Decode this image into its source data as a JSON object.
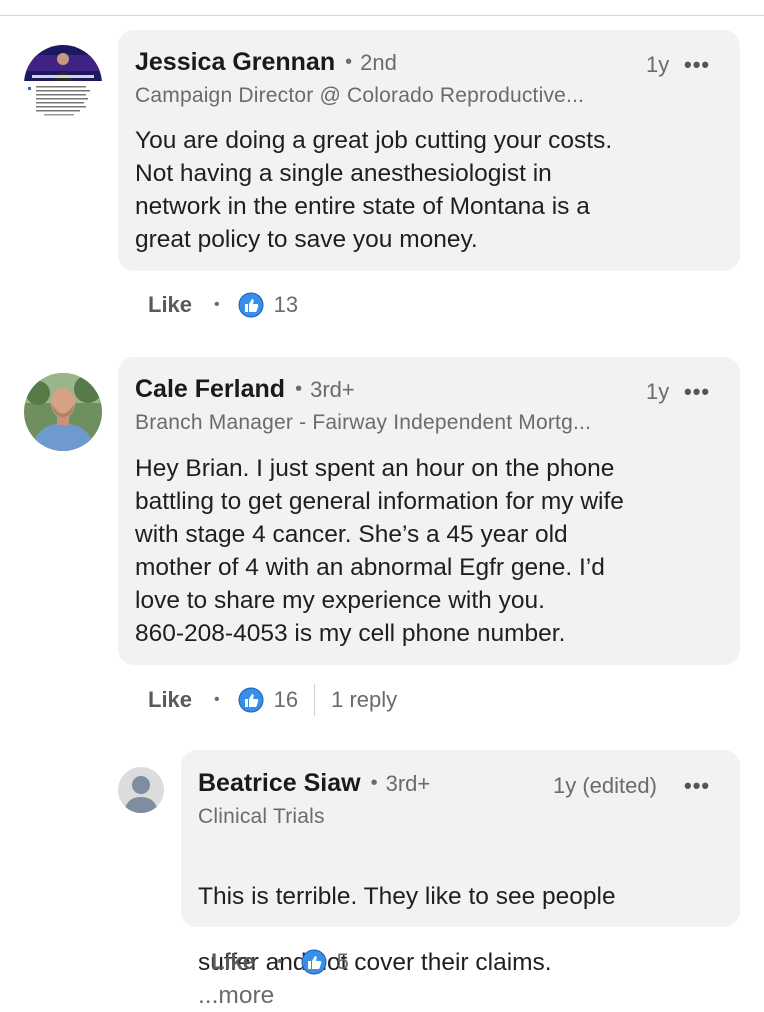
{
  "comments": [
    {
      "name": "Jessica Grennan",
      "degree": "2nd",
      "time": "1y",
      "headline": "Campaign Director @ Colorado Reproductive...",
      "text": "You are doing a great job cutting your costs.\nNot having a single anesthesiologist in\nnetwork in the entire state of Montana is a\ngreat policy to save you money.",
      "like_label": "Like",
      "reactions": "13"
    },
    {
      "name": "Cale Ferland",
      "degree": "3rd+",
      "time": "1y",
      "headline": "Branch Manager - Fairway Independent Mortg...",
      "text": "Hey Brian. I just spent an hour on the phone\nbattling to get general information for my wife\nwith stage 4 cancer. She’s a 45 year old\nmother of 4 with an abnormal Egfr gene. I’d\nlove to share my experience with you.\n860-208-4053 is my cell phone number.",
      "like_label": "Like",
      "reactions": "16",
      "replies": "1 reply"
    }
  ],
  "reply": {
    "name": "Beatrice Siaw",
    "degree": "3rd+",
    "time": "1y (edited)",
    "headline": "Clinical Trials",
    "text_line1": "This is terrible. They like to see people",
    "text_line2": "suffer and not cover their claims.",
    "more": "...more",
    "like_label": "Like",
    "reactions": "5"
  },
  "separators": {
    "meta": "•",
    "action": "•",
    "menu": "•••"
  },
  "colors": {
    "bubble": "#f2f2f2",
    "like_blue": "#378fe9",
    "secondary_text": "#6b6b6b"
  },
  "icons": {
    "like": "thumbs-up-icon",
    "menu": "more-options-icon"
  }
}
